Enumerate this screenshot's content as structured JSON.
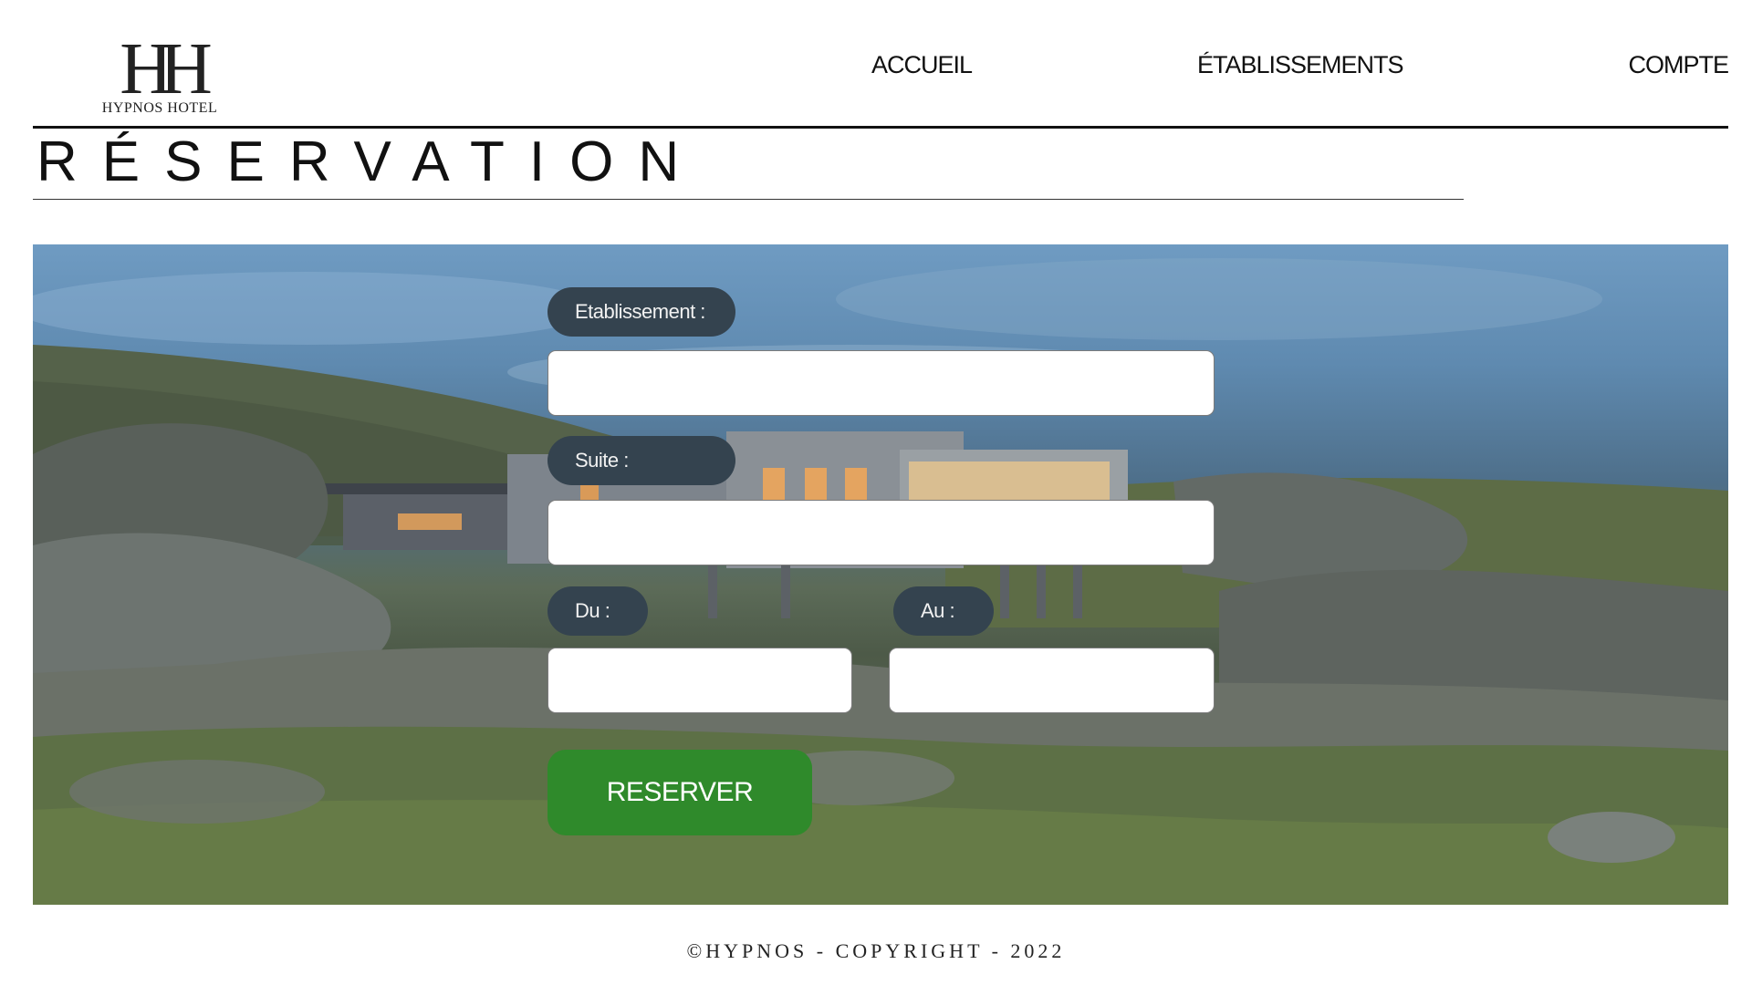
{
  "header": {
    "logo_mark": "HH",
    "logo_text": "HYPNOS HOTEL",
    "nav": [
      {
        "label": "ACCUEIL"
      },
      {
        "label": "ÉTABLISSEMENTS"
      },
      {
        "label": "COMPTE"
      }
    ]
  },
  "page": {
    "title": "RÉSERVATION"
  },
  "form": {
    "etablissement_label": "Etablissement :",
    "etablissement_value": "",
    "suite_label": "Suite :",
    "suite_value": "",
    "du_label": "Du :",
    "du_value": "",
    "au_label": "Au :",
    "au_value": "",
    "submit_label": "RESERVER"
  },
  "footer": {
    "text": "©HYPNOS - COPYRIGHT - 2022"
  },
  "colors": {
    "label_bg": "#34434f",
    "button_bg": "#2f8a2b",
    "text": "#111111"
  }
}
